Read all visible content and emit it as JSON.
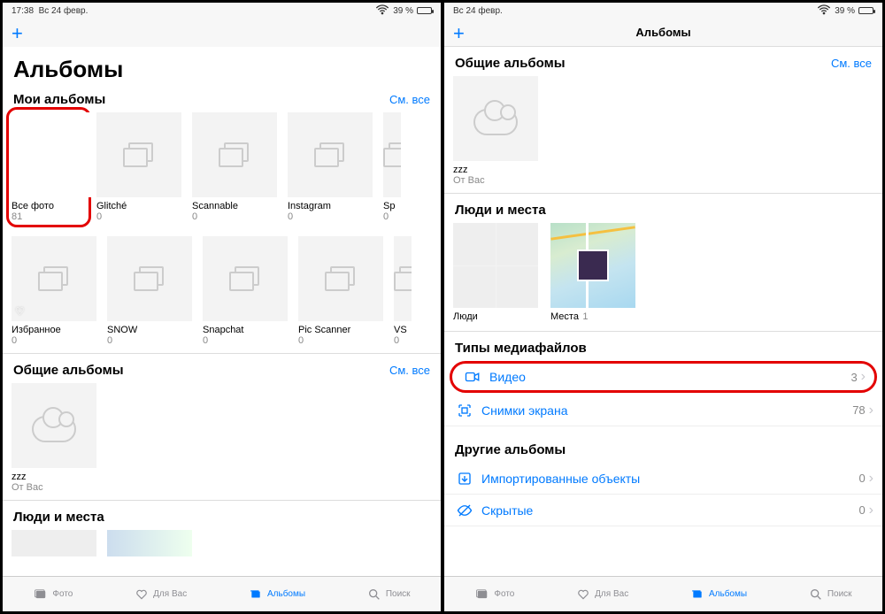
{
  "status": {
    "time": "17:38",
    "date": "Вс 24 февр.",
    "battery": "39 %"
  },
  "accent": "#007aff",
  "left": {
    "large_title": "Альбомы",
    "my_albums": {
      "title": "Мои альбомы",
      "see_all": "См. все"
    },
    "albums_row1": [
      {
        "name": "Все фото",
        "count": "81"
      },
      {
        "name": "Glitché",
        "count": "0"
      },
      {
        "name": "Scannable",
        "count": "0"
      },
      {
        "name": "Instagram",
        "count": "0"
      },
      {
        "name": "Sp",
        "count": "0"
      }
    ],
    "albums_row2": [
      {
        "name": "Избранное",
        "count": "0"
      },
      {
        "name": "SNOW",
        "count": "0"
      },
      {
        "name": "Snapchat",
        "count": "0"
      },
      {
        "name": "Pic Scanner",
        "count": "0"
      },
      {
        "name": "VS",
        "count": "0"
      }
    ],
    "shared": {
      "title": "Общие альбомы",
      "see_all": "См. все",
      "item_name": "zzz",
      "item_sub": "От Вас"
    },
    "people_places": {
      "title": "Люди и места"
    }
  },
  "right": {
    "nav_title": "Альбомы",
    "shared": {
      "title": "Общие альбомы",
      "see_all": "См. все",
      "item_name": "zzz",
      "item_sub": "От Вас"
    },
    "people_places": {
      "title": "Люди и места",
      "people_label": "Люди",
      "places_label": "Места",
      "places_count": "1"
    },
    "media_types": {
      "title": "Типы медиафайлов",
      "rows": [
        {
          "label": "Видео",
          "count": "3"
        },
        {
          "label": "Снимки экрана",
          "count": "78"
        }
      ]
    },
    "other": {
      "title": "Другие альбомы",
      "rows": [
        {
          "label": "Импортированные объекты",
          "count": "0"
        },
        {
          "label": "Скрытые",
          "count": "0"
        }
      ]
    }
  },
  "tabs": [
    {
      "label": "Фото"
    },
    {
      "label": "Для Вас"
    },
    {
      "label": "Альбомы"
    },
    {
      "label": "Поиск"
    }
  ]
}
